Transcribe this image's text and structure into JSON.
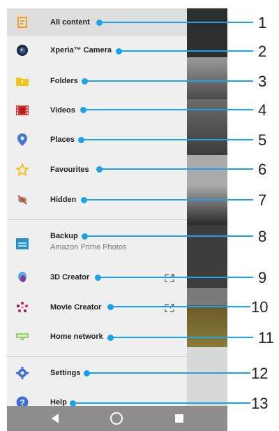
{
  "menu": {
    "items": [
      {
        "label": "All content",
        "icon": "all-content-icon"
      },
      {
        "label": "Xperia™ Camera",
        "icon": "camera-icon"
      },
      {
        "label": "Folders",
        "icon": "folder-icon"
      },
      {
        "label": "Videos",
        "icon": "videos-icon"
      },
      {
        "label": "Places",
        "icon": "places-icon"
      },
      {
        "label": "Favourites",
        "icon": "star-icon"
      },
      {
        "label": "Hidden",
        "icon": "hidden-icon"
      },
      {
        "label": "Backup",
        "sublabel": "Amazon Prime Photos",
        "icon": "backup-icon"
      },
      {
        "label": "3D Creator",
        "icon": "3d-creator-icon"
      },
      {
        "label": "Movie Creator",
        "icon": "movie-creator-icon"
      },
      {
        "label": "Home network",
        "icon": "home-network-icon"
      },
      {
        "label": "Settings",
        "icon": "settings-icon"
      },
      {
        "label": "Help",
        "icon": "help-icon"
      }
    ]
  },
  "callouts": [
    "1",
    "2",
    "3",
    "4",
    "5",
    "6",
    "7",
    "8",
    "9",
    "10",
    "11",
    "12",
    "13"
  ],
  "colors": {
    "accent": "#1aa3e8",
    "selected_row": "#dedede",
    "drawer_bg": "#efefef",
    "navbar": "#8d8d8d"
  }
}
